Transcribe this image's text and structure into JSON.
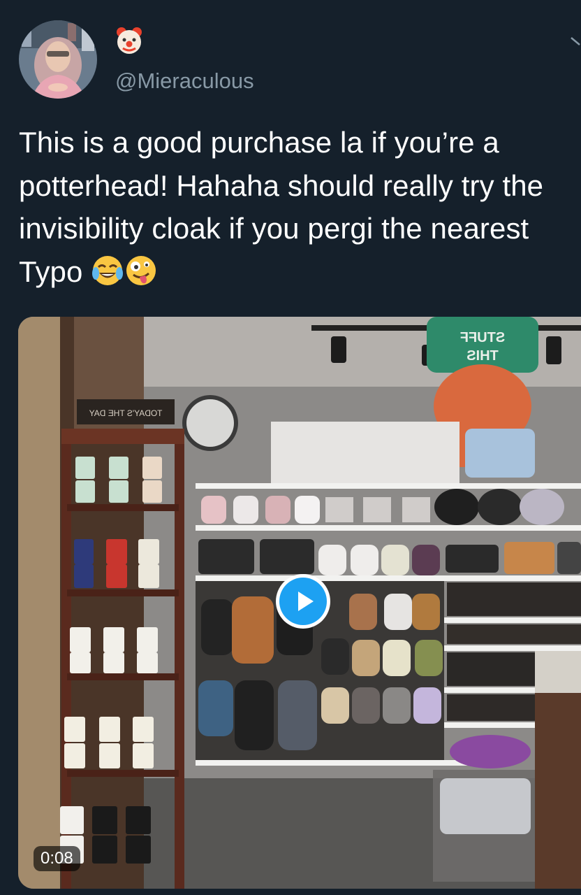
{
  "tweet": {
    "display_name": "🤡",
    "handle": "@Mieraculous",
    "text": "This is a good purchase la if you’re a potterhead! Hahaha should really try the invisibility cloak if you pergi the nearest Typo ",
    "emojis": [
      "face-with-tears-of-joy",
      "zany-face"
    ]
  },
  "media": {
    "type": "video",
    "duration": "0:08",
    "sign_text": "STUFF THIS",
    "shelf_sign": "TODAY'S THE DAY"
  },
  "colors": {
    "background": "#15202b",
    "secondary_text": "#8899a6",
    "accent": "#1da1f2"
  }
}
